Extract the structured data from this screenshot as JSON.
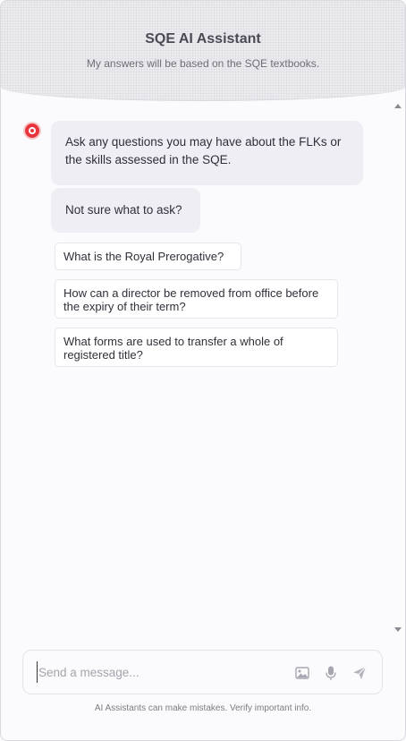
{
  "header": {
    "title": "SQE AI Assistant",
    "subtitle": "My answers will be based on the SQE textbooks."
  },
  "messages": [
    {
      "text": "Ask any questions you may have about the FLKs or the skills assessed in the SQE."
    },
    {
      "text": "Not sure what to ask?"
    }
  ],
  "suggestions": [
    {
      "text": "What is the Royal Prerogative?"
    },
    {
      "text": "How can a director be removed from office before the expiry of their term?"
    },
    {
      "text": "What forms are used to transfer a whole of registered title?"
    }
  ],
  "composer": {
    "placeholder": "Send a message...",
    "icons": [
      "image-icon",
      "microphone-icon",
      "send-icon"
    ]
  },
  "footer": {
    "note": "AI Assistants can make mistakes. Verify important info."
  },
  "colors": {
    "accent": "#e8353d",
    "bubble": "#eeeef4",
    "background": "#fbfbfd"
  }
}
